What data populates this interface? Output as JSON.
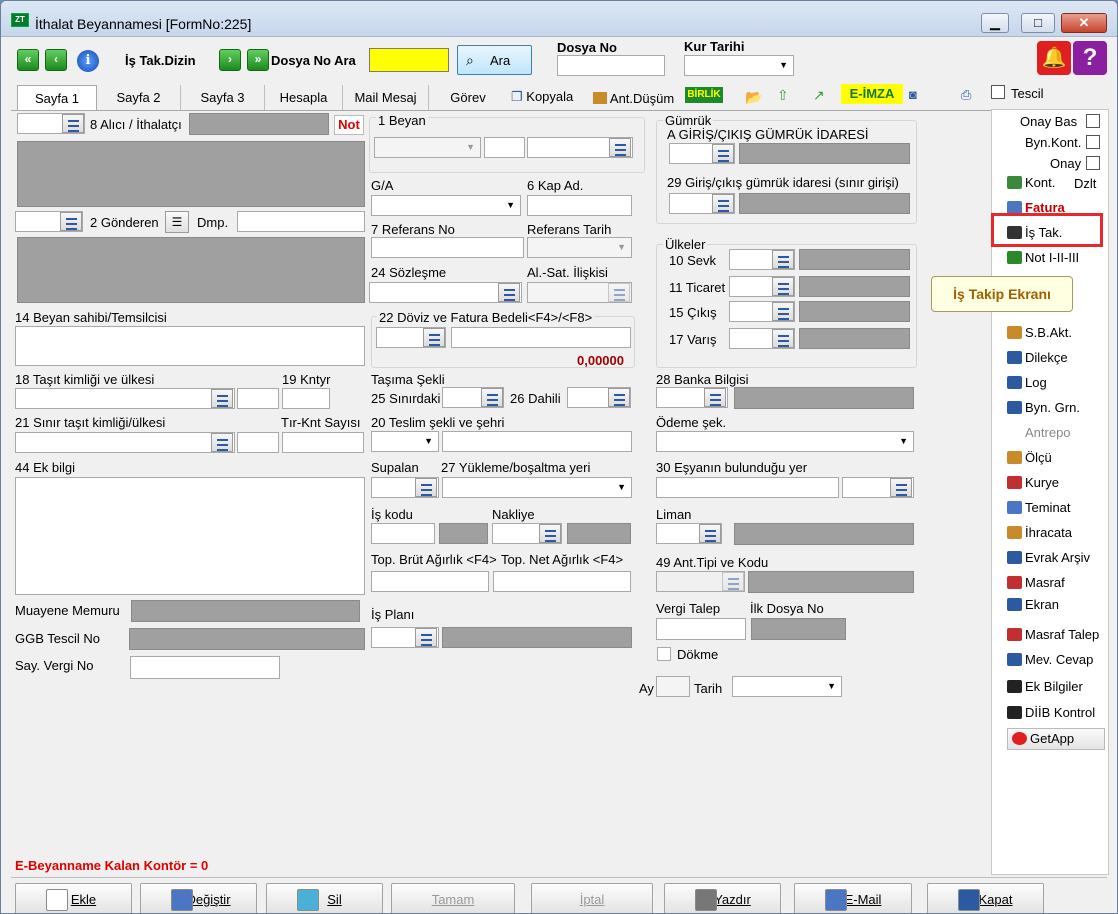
{
  "window": {
    "title": "İthalat Beyannamesi [FormNo:225]",
    "app_icon": "ZT"
  },
  "toolbar": {
    "is_tak_dizin": "İş Tak.Dizin",
    "dosya_no_ara": "Dosya No Ara",
    "ara_button": "Ara",
    "dosya_no_label": "Dosya No",
    "kur_tarihi_label": "Kur Tarihi",
    "icons": [
      "first-icon",
      "prev-icon",
      "info-icon",
      "next-icon",
      "last-icon",
      "search-icon",
      "alarm-bell-icon",
      "help-icon"
    ]
  },
  "tabs": [
    "Sayfa 1",
    "Sayfa 2",
    "Sayfa 3",
    "Hesapla",
    "Mail Mesaj",
    "Görev"
  ],
  "tabbar_actions": {
    "kopyala": "Kopyala",
    "ant_dusum": "Ant.Düşüm",
    "birlik": "BİRLİK",
    "e_imza": "E-İMZA",
    "tescil": "Tescil"
  },
  "form": {
    "alici_label": "8 Alıcı / İthalatçı",
    "not_label": "Not",
    "gonderen_label": "2 Gönderen",
    "dmp_label": "Dmp.",
    "beyan_sahibi_label": "14 Beyan sahibi/Temsilcisi",
    "tasit_label": "18 Taşıt kimliği ve ülkesi",
    "kntyr_label": "19 Kntyr",
    "sinir_tasit_label": "21 Sınır taşıt kimliği/ülkesi",
    "tir_knt_label": "Tır-Knt Sayısı",
    "ek_bilgi_label": "44 Ek bilgi",
    "muayene_label": "Muayene Memuru",
    "ggb_label": "GGB Tescil No",
    "vergi_no_label": "Say. Vergi No",
    "beyan_label": "1 Beyan",
    "ga_label": "G/A",
    "kap_label": "6 Kap Ad.",
    "referans_no_label": "7 Referans No",
    "referans_tarih_label": "Referans Tarih",
    "sozlesme_label": "24 Sözleşme",
    "alsat_label": "Al.-Sat. İlişkisi",
    "doviz_label": "22 Döviz ve Fatura Bedeli<F4>/<F8>",
    "doviz_value": "0,00000",
    "tasima_label": "Taşıma Şekli",
    "sinirdaki_label": "25 Sınırdaki",
    "dahili_label": "26 Dahili",
    "teslim_label": "20 Teslim şekli ve şehri",
    "supalan_label": "Supalan",
    "yukleme_label": "27 Yükleme/boşaltma yeri",
    "is_kodu_label": "İş kodu",
    "nakliye_label": "Nakliye",
    "brut_label": "Top. Brüt Ağırlık <F4>",
    "net_label": "Top. Net Ağırlık <F4>",
    "is_plani_label": "İş Planı",
    "gumruk_label": "Gümrük",
    "giris_cikis_label": "A GİRİŞ/ÇIKIŞ GÜMRÜK İDARESİ",
    "sinir_girisi_label": "29 Giriş/çıkış gümrük idaresi (sınır girişi)",
    "ulkeler_label": "Ülkeler",
    "sevk_label": "10 Sevk",
    "ticaret_label": "11 Ticaret",
    "cikis_label": "15 Çıkış",
    "varis_label": "17 Varış",
    "banka_label": "28 Banka Bilgisi",
    "odeme_label": "Ödeme şek.",
    "esya_yer_label": "30 Eşyanın bulunduğu yer",
    "liman_label": "Liman",
    "ant_tipi_label": "49 Ant.Tipi ve Kodu",
    "vergi_talep_label": "Vergi Talep",
    "ilk_dosya_label": "İlk Dosya No",
    "dokme_label": "Dökme",
    "ay_label": "Ay",
    "tarih_label": "Tarih",
    "kontor_text": "E-Beyanname Kalan Kontör = 0"
  },
  "sidebar": {
    "onay_bas": "Onay Bas",
    "byn_kont": "Byn.Kont.",
    "onay": "Onay",
    "kont": "Kont.",
    "dzlt": "Dzlt",
    "items": [
      {
        "label": "Fatura",
        "icon": "invoice-icon",
        "color": "#c00000",
        "bold": true
      },
      {
        "label": "İş Tak.",
        "icon": "job-track-icon",
        "color": "#000",
        "bold": false
      },
      {
        "label": "Not I-II-III",
        "icon": "note-icon",
        "color": "#000",
        "bold": false
      },
      {
        "label": "S.B.Akt.",
        "icon": "transfer-icon",
        "color": "#000",
        "bold": false
      },
      {
        "label": "Dilekçe",
        "icon": "petition-icon",
        "color": "#000",
        "bold": false
      },
      {
        "label": "Log",
        "icon": "log-icon",
        "color": "#000",
        "bold": false
      },
      {
        "label": "Byn. Grn.",
        "icon": "declaration-icon",
        "color": "#000",
        "bold": false
      },
      {
        "label": "Antrepo",
        "icon": "warehouse-icon",
        "color": "#888",
        "bold": false
      },
      {
        "label": "Ölçü",
        "icon": "scale-icon",
        "color": "#000",
        "bold": false
      },
      {
        "label": "Kurye",
        "icon": "courier-icon",
        "color": "#000",
        "bold": false
      },
      {
        "label": "Teminat",
        "icon": "guarantee-icon",
        "color": "#000",
        "bold": false
      },
      {
        "label": "İhracata",
        "icon": "export-icon",
        "color": "#000",
        "bold": false
      },
      {
        "label": "Evrak Arşiv",
        "icon": "archive-icon",
        "color": "#000",
        "bold": false
      },
      {
        "label": "Masraf",
        "icon": "expense-icon",
        "color": "#000",
        "bold": false
      },
      {
        "label": "Ekran",
        "icon": "screen-icon",
        "color": "#000",
        "bold": false
      },
      {
        "label": "Masraf Talep",
        "icon": "expense-request-icon",
        "color": "#000",
        "bold": false
      },
      {
        "label": "Mev. Cevap",
        "icon": "response-icon",
        "color": "#000",
        "bold": false
      },
      {
        "label": "Ek Bilgiler",
        "icon": "extra-info-icon",
        "color": "#000",
        "bold": false
      },
      {
        "label": "DİİB Kontrol",
        "icon": "control-icon",
        "color": "#000",
        "bold": false
      },
      {
        "label": "GetApp",
        "icon": "getapp-icon",
        "color": "#000",
        "bold": false
      }
    ],
    "tooltip": "İş Takip Ekranı"
  },
  "bottom_buttons": [
    {
      "label": "Ekle",
      "icon": "add-icon",
      "enabled": true
    },
    {
      "label": "Değiştir",
      "icon": "edit-icon",
      "enabled": true
    },
    {
      "label": "Sil",
      "icon": "delete-icon",
      "enabled": true
    },
    {
      "label": "Tamam",
      "icon": "",
      "enabled": false
    },
    {
      "label": "İptal",
      "icon": "",
      "enabled": false
    },
    {
      "label": "Yazdır",
      "icon": "print-icon",
      "enabled": true
    },
    {
      "label": "E-Mail",
      "icon": "email-icon",
      "enabled": true
    },
    {
      "label": "Kapat",
      "icon": "exit-icon",
      "enabled": true
    }
  ]
}
